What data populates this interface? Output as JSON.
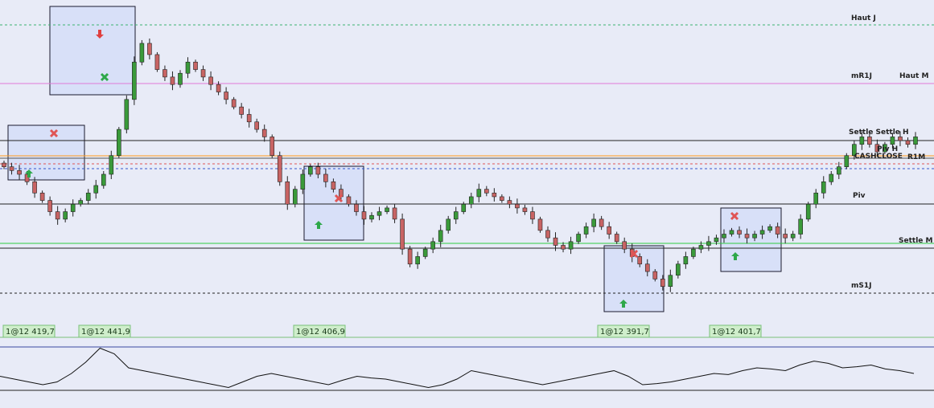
{
  "colors": {
    "background": "#e8ebf7",
    "bull": "#3a9a3a",
    "bear": "#c86464",
    "box_fill": "#d8e0f8",
    "box_stroke": "#1a1a2e",
    "entry_arrow": "#2ea84a",
    "exit_cross": "#e05555",
    "trade_label_bg": "#cfeecb",
    "trade_label_border": "#7ac07a"
  },
  "levels": [
    {
      "label": "Haut J",
      "style": "dashed",
      "color": "#3cb371"
    },
    {
      "label": "mR1J",
      "style": "solid",
      "color": "#e07ad8"
    },
    {
      "label": "Haut M",
      "style": "solid",
      "color": "#e07ad8"
    },
    {
      "label": "Settle Settle H",
      "style": "solid",
      "color": "#222222"
    },
    {
      "label": "Piv H",
      "style": "solid",
      "color": "#ff9a1a"
    },
    {
      "label": "CASHCLOSE",
      "style": "solid",
      "color": "#555555"
    },
    {
      "label": "R1M",
      "style": "dashed",
      "color": "#e05555"
    },
    {
      "label": "Piv",
      "style": "dashed",
      "color": "#3355cc"
    },
    {
      "label": "Settle M",
      "style": "solid",
      "color": "#2ecc40"
    },
    {
      "label": "mS1J",
      "style": "dashed",
      "color": "#222222"
    }
  ],
  "trade_labels": [
    "1@12 419,7",
    "1@12 441,9",
    "1@12 406,9",
    "1@12 391,7",
    "1@12 401,7"
  ],
  "chart_data": {
    "type": "candlestick",
    "closes": [
      12422,
      12421,
      12420,
      12418,
      12415,
      12413,
      12410,
      12408,
      12410,
      12412,
      12413,
      12415,
      12417,
      12420,
      12425,
      12432,
      12440,
      12450,
      12455,
      12452,
      12448,
      12446,
      12444,
      12447,
      12450,
      12448,
      12446,
      12444,
      12442,
      12440,
      12438,
      12436,
      12434,
      12432,
      12430,
      12425,
      12418,
      12412,
      12416,
      12420,
      12422,
      12420,
      12418,
      12416,
      12414,
      12412,
      12410,
      12408,
      12409,
      12410,
      12411,
      12408,
      12400,
      12396,
      12398,
      12400,
      12402,
      12405,
      12408,
      12410,
      12412,
      12414,
      12416,
      12415,
      12414,
      12413,
      12412,
      12411,
      12410,
      12408,
      12405,
      12403,
      12401,
      12400,
      12402,
      12404,
      12406,
      12408,
      12406,
      12404,
      12402,
      12400,
      12398,
      12396,
      12394,
      12392,
      12390,
      12393,
      12396,
      12398,
      12400,
      12401,
      12402,
      12403,
      12404,
      12405,
      12404,
      12403,
      12404,
      12405,
      12406,
      12404,
      12403,
      12404,
      12408,
      12412,
      12415,
      12418,
      12420,
      12422,
      12425,
      12428,
      12430,
      12428,
      12426,
      12428,
      12430,
      12429,
      12428,
      12430
    ],
    "indicator": [
      0.45,
      0.4,
      0.35,
      0.3,
      0.35,
      0.5,
      0.7,
      0.95,
      0.85,
      0.6,
      0.55,
      0.5,
      0.45,
      0.4,
      0.35,
      0.3,
      0.25,
      0.35,
      0.45,
      0.5,
      0.45,
      0.4,
      0.35,
      0.3,
      0.38,
      0.45,
      0.42,
      0.4,
      0.35,
      0.3,
      0.25,
      0.3,
      0.4,
      0.55,
      0.5,
      0.45,
      0.4,
      0.35,
      0.3,
      0.35,
      0.4,
      0.45,
      0.5,
      0.55,
      0.45,
      0.3,
      0.32,
      0.35,
      0.4,
      0.45,
      0.5,
      0.48,
      0.55,
      0.6,
      0.58,
      0.55,
      0.65,
      0.72,
      0.68,
      0.6,
      0.62,
      0.65,
      0.58,
      0.55,
      0.5
    ],
    "indicator_range": [
      -1,
      1
    ]
  }
}
